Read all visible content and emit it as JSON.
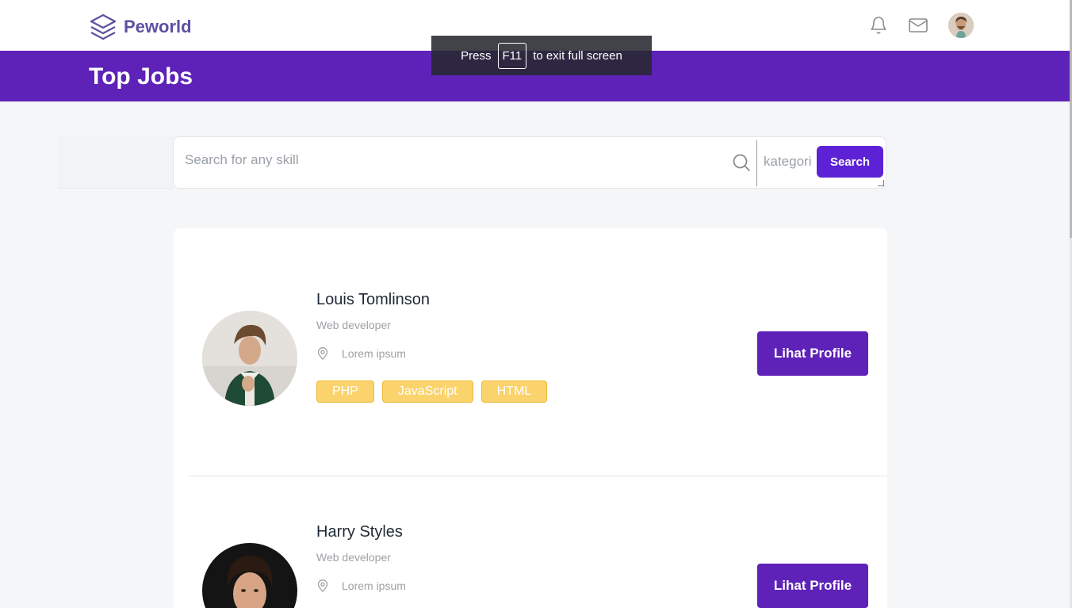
{
  "navbar": {
    "brand": "Peworld",
    "icons": [
      "bell-icon",
      "mail-icon",
      "avatar"
    ]
  },
  "banner": {
    "title": "Top Jobs"
  },
  "fullscreen_toast": {
    "prefix": "Press",
    "key": "F11",
    "suffix": "to exit full screen"
  },
  "search": {
    "placeholder": "Search for any skill",
    "category": "kategori",
    "button": "Search"
  },
  "workers": [
    {
      "name": "Louis Tomlinson",
      "job": "Web developer",
      "location": "Lorem ipsum",
      "skills": [
        "PHP",
        "JavaScript",
        "HTML"
      ],
      "button": "Lihat Profile"
    },
    {
      "name": "Harry Styles",
      "job": "Web developer",
      "location": "Lorem ipsum",
      "button": "Lihat Profile"
    }
  ],
  "colors": {
    "brand": "#5e50a1",
    "banner": "#5e22b8",
    "search_button": "#5e22d6",
    "skill_badge": "#fbd36c"
  }
}
